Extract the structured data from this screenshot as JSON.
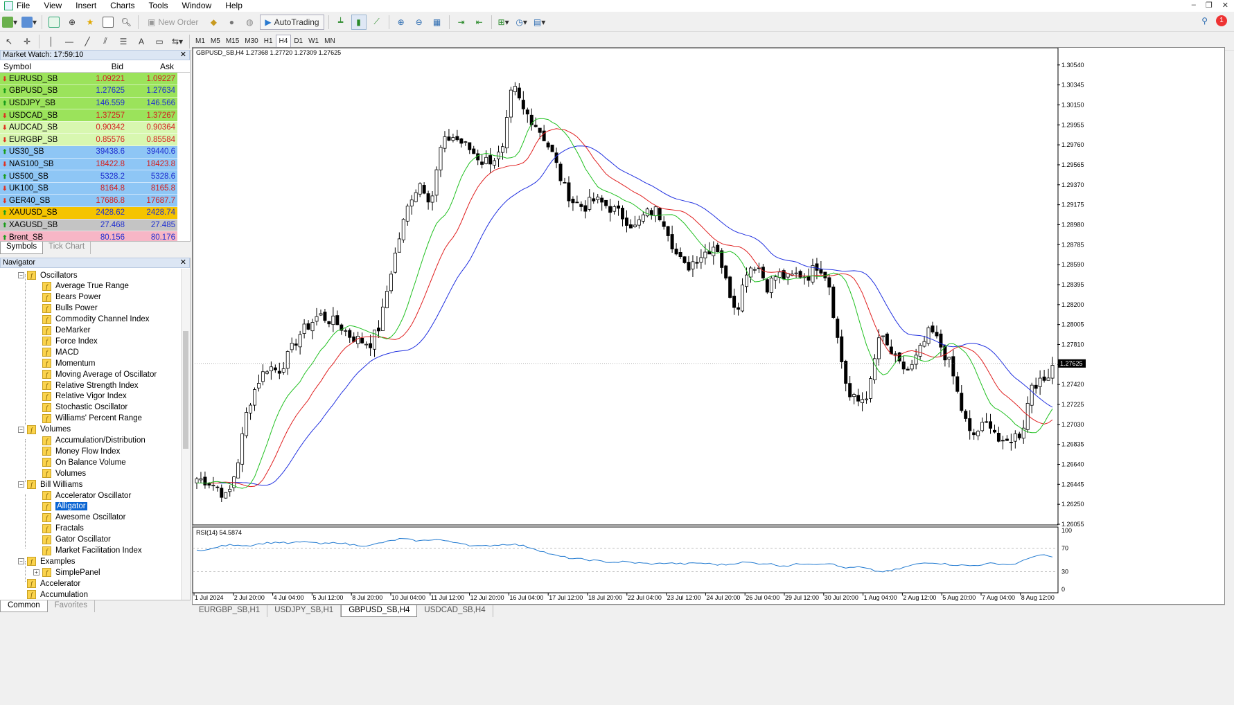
{
  "menu": [
    "File",
    "View",
    "Insert",
    "Charts",
    "Tools",
    "Window",
    "Help"
  ],
  "toolbar": {
    "new_order": "New Order",
    "auto_trading": "AutoTrading",
    "timeframes": [
      "M1",
      "M5",
      "M15",
      "M30",
      "H1",
      "H4",
      "D1",
      "W1",
      "MN"
    ],
    "active_timeframe": "H4",
    "notifications": "1"
  },
  "market_watch": {
    "title": "Market Watch: 17:59:10",
    "col_symbol": "Symbol",
    "col_bid": "Bid",
    "col_ask": "Ask",
    "rows": [
      {
        "symbol": "EURUSD_SB",
        "bid": "1.09221",
        "ask": "1.09227",
        "dir": "down",
        "bg": "#9be35b",
        "color": "#d32020"
      },
      {
        "symbol": "GBPUSD_SB",
        "bid": "1.27625",
        "ask": "1.27634",
        "dir": "up",
        "bg": "#9be35b",
        "color": "#1f2fd0"
      },
      {
        "symbol": "USDJPY_SB",
        "bid": "146.559",
        "ask": "146.566",
        "dir": "up",
        "bg": "#9be35b",
        "color": "#1f2fd0"
      },
      {
        "symbol": "USDCAD_SB",
        "bid": "1.37257",
        "ask": "1.37267",
        "dir": "down",
        "bg": "#9be35b",
        "color": "#d32020"
      },
      {
        "symbol": "AUDCAD_SB",
        "bid": "0.90342",
        "ask": "0.90364",
        "dir": "down",
        "bg": "#d8f7b0",
        "color": "#d32020"
      },
      {
        "symbol": "EURGBP_SB",
        "bid": "0.85576",
        "ask": "0.85584",
        "dir": "down",
        "bg": "#d8f7b0",
        "color": "#d32020"
      },
      {
        "symbol": "US30_SB",
        "bid": "39438.6",
        "ask": "39440.6",
        "dir": "up",
        "bg": "#8ec6f5",
        "color": "#1f2fd0"
      },
      {
        "symbol": "NAS100_SB",
        "bid": "18422.8",
        "ask": "18423.8",
        "dir": "down",
        "bg": "#8ec6f5",
        "color": "#d32020"
      },
      {
        "symbol": "US500_SB",
        "bid": "5328.2",
        "ask": "5328.6",
        "dir": "up",
        "bg": "#8ec6f5",
        "color": "#1f2fd0"
      },
      {
        "symbol": "UK100_SB",
        "bid": "8164.8",
        "ask": "8165.8",
        "dir": "down",
        "bg": "#8ec6f5",
        "color": "#d32020"
      },
      {
        "symbol": "GER40_SB",
        "bid": "17686.8",
        "ask": "17687.7",
        "dir": "down",
        "bg": "#8ec6f5",
        "color": "#d32020"
      },
      {
        "symbol": "XAUUSD_SB",
        "bid": "2428.62",
        "ask": "2428.74",
        "dir": "up",
        "bg": "#f5c400",
        "color": "#1f2fd0"
      },
      {
        "symbol": "XAGUSD_SB",
        "bid": "27.468",
        "ask": "27.485",
        "dir": "up",
        "bg": "#c4c4c4",
        "color": "#1f2fd0"
      },
      {
        "symbol": "Brent_SB",
        "bid": "80.156",
        "ask": "80.176",
        "dir": "up",
        "bg": "#f7b6c6",
        "color": "#1f2fd0"
      }
    ],
    "tabs": [
      "Symbols",
      "Tick Chart"
    ]
  },
  "navigator": {
    "title": "Navigator",
    "items": [
      {
        "label": "Oscillators",
        "level": 1,
        "folder": true
      },
      {
        "label": "Average True Range",
        "level": 2
      },
      {
        "label": "Bears Power",
        "level": 2
      },
      {
        "label": "Bulls Power",
        "level": 2
      },
      {
        "label": "Commodity Channel Index",
        "level": 2
      },
      {
        "label": "DeMarker",
        "level": 2
      },
      {
        "label": "Force Index",
        "level": 2
      },
      {
        "label": "MACD",
        "level": 2
      },
      {
        "label": "Momentum",
        "level": 2
      },
      {
        "label": "Moving Average of Oscillator",
        "level": 2
      },
      {
        "label": "Relative Strength Index",
        "level": 2
      },
      {
        "label": "Relative Vigor Index",
        "level": 2
      },
      {
        "label": "Stochastic Oscillator",
        "level": 2
      },
      {
        "label": "Williams' Percent Range",
        "level": 2
      },
      {
        "label": "Volumes",
        "level": 1,
        "folder": true
      },
      {
        "label": "Accumulation/Distribution",
        "level": 2
      },
      {
        "label": "Money Flow Index",
        "level": 2
      },
      {
        "label": "On Balance Volume",
        "level": 2
      },
      {
        "label": "Volumes",
        "level": 2
      },
      {
        "label": "Bill Williams",
        "level": 1,
        "folder": true
      },
      {
        "label": "Accelerator Oscillator",
        "level": 2
      },
      {
        "label": "Alligator",
        "level": 2,
        "selected": true
      },
      {
        "label": "Awesome Oscillator",
        "level": 2
      },
      {
        "label": "Fractals",
        "level": 2
      },
      {
        "label": "Gator Oscillator",
        "level": 2
      },
      {
        "label": "Market Facilitation Index",
        "level": 2
      },
      {
        "label": "Examples",
        "level": 1,
        "folder": true
      },
      {
        "label": "SimplePanel",
        "level": 2,
        "plus": true
      },
      {
        "label": "Accelerator",
        "level": 1
      },
      {
        "label": "Accumulation",
        "level": 1
      }
    ],
    "tabs": [
      "Common",
      "Favorites"
    ]
  },
  "chart": {
    "header": "GBPUSD_SB,H4  1.27368 1.27720 1.27309 1.27625",
    "rsi_header": "RSI(14) 54.5874",
    "current_price": "1.27625"
  },
  "chart_data": {
    "type": "candlestick",
    "symbol": "GBPUSD_SB",
    "timeframe": "H4",
    "y_ticks": [
      "1.30540",
      "1.30345",
      "1.30150",
      "1.29955",
      "1.29760",
      "1.29565",
      "1.29370",
      "1.29175",
      "1.28980",
      "1.28785",
      "1.28590",
      "1.28395",
      "1.28200",
      "1.28005",
      "1.27810",
      "1.27615",
      "1.27420",
      "1.27225",
      "1.27030",
      "1.26835",
      "1.26640",
      "1.26445",
      "1.26250",
      "1.26055"
    ],
    "ylim": [
      1.26055,
      1.3064
    ],
    "x_ticks": [
      "1 Jul 2024",
      "2 Jul 20:00",
      "4 Jul 04:00",
      "5 Jul 12:00",
      "8 Jul 20:00",
      "10 Jul 04:00",
      "11 Jul 12:00",
      "12 Jul 20:00",
      "16 Jul 04:00",
      "17 Jul 12:00",
      "18 Jul 20:00",
      "22 Jul 04:00",
      "23 Jul 12:00",
      "24 Jul 20:00",
      "26 Jul 04:00",
      "29 Jul 12:00",
      "30 Jul 20:00",
      "1 Aug 04:00",
      "2 Aug 12:00",
      "5 Aug 20:00",
      "7 Aug 04:00",
      "8 Aug 12:00"
    ],
    "close_path": [
      1.265,
      1.2648,
      1.2642,
      1.263,
      1.2665,
      1.272,
      1.2745,
      1.276,
      1.2755,
      1.277,
      1.279,
      1.28,
      1.281,
      1.2805,
      1.28,
      1.279,
      1.2785,
      1.2782,
      1.28,
      1.285,
      1.289,
      1.2925,
      1.294,
      1.292,
      1.2975,
      1.2985,
      1.2978,
      1.297,
      1.296,
      1.2962,
      1.2968,
      1.3035,
      1.301,
      1.3,
      1.2985,
      1.2965,
      1.2935,
      1.292,
      1.2915,
      1.2922,
      1.2918,
      1.2912,
      1.2905,
      1.2895,
      1.2908,
      1.2912,
      1.29,
      1.287,
      1.2855,
      1.2865,
      1.2872,
      1.288,
      1.284,
      1.2815,
      1.2855,
      1.286,
      1.2838,
      1.285,
      1.2845,
      1.285,
      1.2848,
      1.286,
      1.2845,
      1.278,
      1.273,
      1.2725,
      1.2735,
      1.279,
      1.2775,
      1.276,
      1.2755,
      1.2775,
      1.2795,
      1.278,
      1.276,
      1.272,
      1.269,
      1.27,
      1.2705,
      1.268,
      1.269,
      1.2695,
      1.2745,
      1.2742,
      1.2762
    ],
    "series": [
      {
        "name": "jaw",
        "color": "#2030e0"
      },
      {
        "name": "teeth",
        "color": "#e02020"
      },
      {
        "name": "lips",
        "color": "#20c020"
      }
    ],
    "rsi": {
      "ylim": [
        0,
        100
      ],
      "y_ticks": [
        "100",
        "70",
        "30",
        "0"
      ],
      "levels": [
        70,
        30
      ],
      "values": [
        68,
        66,
        72,
        75,
        76,
        74,
        77,
        79,
        80,
        78,
        80,
        81,
        77,
        78,
        80,
        76,
        75,
        74,
        79,
        82,
        86,
        84,
        82,
        85,
        84,
        80,
        79,
        74,
        73,
        75,
        76,
        77,
        74,
        70,
        64,
        58,
        55,
        52,
        51,
        49,
        47,
        46,
        47,
        45,
        44,
        43,
        45,
        44,
        43,
        45,
        44,
        42,
        42,
        45,
        46,
        44,
        44,
        41,
        40,
        43,
        44,
        43,
        45,
        39,
        36,
        38,
        34,
        30,
        31,
        35,
        40,
        44,
        46,
        44,
        42,
        41,
        40,
        42,
        44,
        43,
        42,
        47,
        56,
        58,
        55
      ]
    }
  },
  "bottom_tabs": [
    "EURGBP_SB,H1",
    "USDJPY_SB,H1",
    "GBPUSD_SB,H4",
    "USDCAD_SB,H4"
  ],
  "active_tab": "GBPUSD_SB,H4"
}
